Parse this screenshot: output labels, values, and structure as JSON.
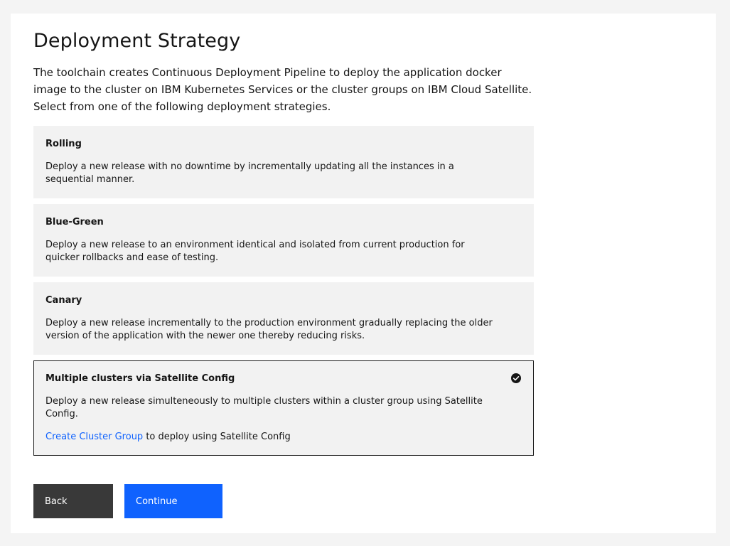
{
  "page": {
    "title": "Deployment Strategy",
    "intro": "The toolchain creates Continuous Deployment Pipeline to deploy the application docker image to the cluster on IBM Kubernetes Services or the cluster groups on IBM Cloud Satellite. Select from one of the following deployment strategies."
  },
  "strategies": [
    {
      "title": "Rolling",
      "description": "Deploy a new release with no downtime by incrementally updating all the instances in a sequential manner."
    },
    {
      "title": "Blue-Green",
      "description": "Deploy a new release to an environment identical and isolated from current production for quicker rollbacks and ease of testing."
    },
    {
      "title": "Canary",
      "description": "Deploy a new release incrementally to the production environment gradually replacing the older version of the application with the newer one thereby reducing risks."
    },
    {
      "title": "Multiple clusters via Satellite Config",
      "description": "Deploy a new release simulteneously to multiple clusters within a cluster group using Satellite Config.",
      "link_text": "Create Cluster Group",
      "link_suffix": " to deploy using Satellite Config",
      "selected": true
    }
  ],
  "selected_icon": "checkmark-filled-icon",
  "actions": {
    "back_label": "Back",
    "continue_label": "Continue"
  },
  "colors": {
    "primary": "#0f62fe",
    "secondary": "#393939",
    "tile_background": "#f2f2f2",
    "page_background": "#f4f4f4"
  }
}
